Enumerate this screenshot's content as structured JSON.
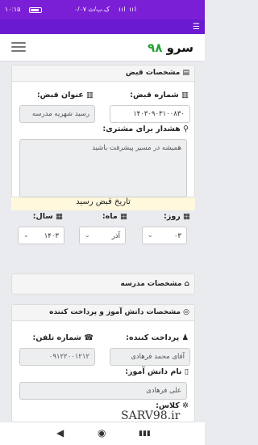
{
  "status": {
    "time": "۱۰:۱۵",
    "network": "۰/۰۷ ک.ب/ث",
    "signal": "ııl ııl"
  },
  "brand": {
    "name": "سرو",
    "number": "۹۸"
  },
  "bill_card": {
    "title": "مشخصات قبض",
    "bill_number_label": "شماره قبض:",
    "bill_number_value": "۱۴۰۳۰۹۰۳۱۰۰۸۳۰",
    "bill_title_label": "عنوان قبض:",
    "bill_title_value": "رسید شهریه مدرسه",
    "warning_label": "هشدار برای مشتری:",
    "warning_value": "همیشه در مسیر پیشرفت باشید"
  },
  "date": {
    "title": "تاریخ قبض رسید",
    "day_label": "روز:",
    "month_label": "ماه:",
    "year_label": "سال:",
    "day_value": "۰۳",
    "month_value": "آذر",
    "year_value": "۱۴۰۳"
  },
  "school_card": {
    "title": "مشخصات مدرسه"
  },
  "payer_card": {
    "title": "مشخصات دانش آموز و پرداخت کننده",
    "payer_label": "پرداخت کننده:",
    "payer_value": "آقای محمد فرهادی",
    "phone_label": "شماره تلفن:",
    "phone_value": "۰۹۱۲۲۰۰۱۲۱۲",
    "student_label": "نام دانش آموز:",
    "student_value": "علی فرهادی",
    "class_label": "کلاس:"
  },
  "watermark": "SARV98.ir",
  "nav": {
    "back": "◀",
    "home": "◉",
    "recents": "▮▮▮"
  }
}
